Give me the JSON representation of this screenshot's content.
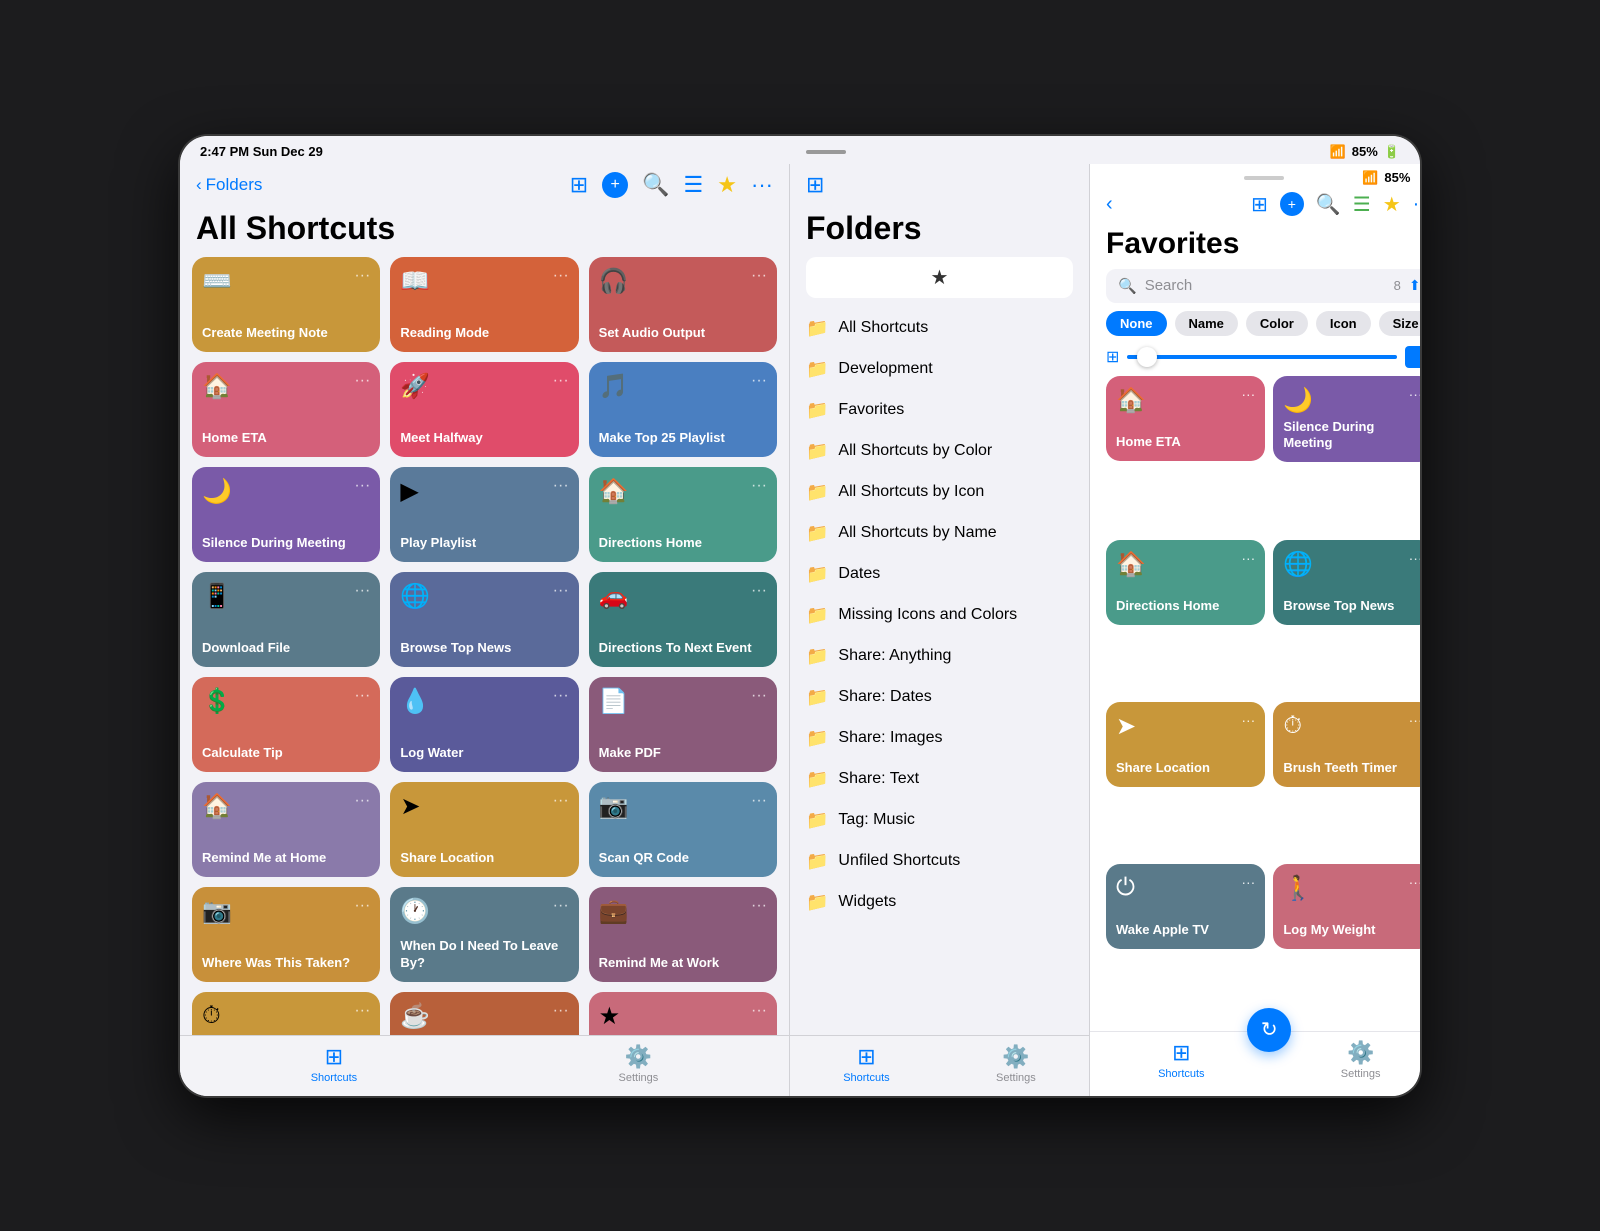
{
  "device": {
    "status_bar": {
      "time": "2:47 PM  Sun Dec 29",
      "wifi": "WiFi",
      "battery": "85%"
    }
  },
  "left_panel": {
    "back_label": "Folders",
    "title": "All Shortcuts",
    "nav_icons": [
      "layers",
      "plus",
      "search",
      "lines",
      "star",
      "dots"
    ],
    "shortcuts": [
      {
        "label": "Create Meeting Note",
        "icon": "⌨️",
        "color": "c-golden"
      },
      {
        "label": "Reading Mode",
        "icon": "📖",
        "color": "c-orange"
      },
      {
        "label": "Set Audio Output",
        "icon": "🎧",
        "color": "c-rose"
      },
      {
        "label": "Home ETA",
        "icon": "🏠",
        "color": "c-pink"
      },
      {
        "label": "Meet Halfway",
        "icon": "🚀",
        "color": "c-rocket"
      },
      {
        "label": "Make Top 25 Playlist",
        "icon": "☰",
        "color": "c-blue"
      },
      {
        "label": "Silence During Meeting",
        "icon": "🌙",
        "color": "c-purple"
      },
      {
        "label": "Play Playlist",
        "icon": "≡",
        "color": "c-gray-blue"
      },
      {
        "label": "Directions Home",
        "icon": "🏠",
        "color": "c-teal"
      },
      {
        "label": "Download File",
        "icon": "📱",
        "color": "c-slate"
      },
      {
        "label": "Browse Top News",
        "icon": "🌐",
        "color": "c-muted-blue"
      },
      {
        "label": "Directions To Next Event",
        "icon": "🚗",
        "color": "c-dark-teal"
      },
      {
        "label": "Calculate Tip",
        "icon": "💲",
        "color": "c-salmon"
      },
      {
        "label": "Log Water",
        "icon": "💧",
        "color": "c-indigo"
      },
      {
        "label": "Make PDF",
        "icon": "📄",
        "color": "c-mauve"
      },
      {
        "label": "Remind Me at Home",
        "icon": "🏠",
        "color": "c-lavender"
      },
      {
        "label": "Share Location",
        "icon": "➤",
        "color": "c-amber"
      },
      {
        "label": "Scan QR Code",
        "icon": "📷",
        "color": "c-steel"
      },
      {
        "label": "Where Was This Taken?",
        "icon": "📷",
        "color": "c-gold"
      },
      {
        "label": "When Do I Need To Leave By?",
        "icon": "🕐",
        "color": "c-slate"
      },
      {
        "label": "Remind Me at Work",
        "icon": "💼",
        "color": "c-mauve"
      },
      {
        "label": "",
        "icon": "⏱",
        "color": "c-amber"
      },
      {
        "label": "",
        "icon": "☕",
        "color": "c-rust"
      },
      {
        "label": "",
        "icon": "★",
        "color": "c-warm-rose"
      }
    ],
    "tab_bar": {
      "shortcuts_label": "Shortcuts",
      "settings_label": "Settings"
    }
  },
  "middle_panel": {
    "title": "Folders",
    "star_label": "★",
    "folders": [
      {
        "label": "All Shortcuts"
      },
      {
        "label": "Development"
      },
      {
        "label": "Favorites"
      },
      {
        "label": "All Shortcuts by Color"
      },
      {
        "label": "All Shortcuts by Icon"
      },
      {
        "label": "All Shortcuts by Name"
      },
      {
        "label": "Dates"
      },
      {
        "label": "Missing Icons and Colors"
      },
      {
        "label": "Share: Anything"
      },
      {
        "label": "Share: Dates"
      },
      {
        "label": "Share: Images"
      },
      {
        "label": "Share: Text"
      },
      {
        "label": "Tag: Music"
      },
      {
        "label": "Unfiled Shortcuts"
      },
      {
        "label": "Widgets"
      }
    ],
    "tab_bar": {
      "shortcuts_label": "Shortcuts",
      "settings_label": "Settings"
    }
  },
  "right_panel": {
    "status_bar": {
      "battery": "85%",
      "wifi": "WiFi"
    },
    "back_label": "‹",
    "title": "Favorites",
    "search_placeholder": "Search",
    "search_count": "8",
    "filter_options": [
      "None",
      "Name",
      "Color",
      "Icon",
      "Size"
    ],
    "active_filter": "None",
    "favorites": [
      {
        "label": "Home ETA",
        "icon": "🏠",
        "color": "c-pink"
      },
      {
        "label": "Silence During Meeting",
        "icon": "🌙",
        "color": "c-purple"
      },
      {
        "label": "Directions Home",
        "icon": "🏠",
        "color": "c-teal"
      },
      {
        "label": "Browse Top News",
        "icon": "🌐",
        "color": "c-dark-teal"
      },
      {
        "label": "Share Location",
        "icon": "➤",
        "color": "c-amber"
      },
      {
        "label": "Brush Teeth Timer",
        "icon": "⏱",
        "color": "c-gold"
      },
      {
        "label": "Wake Apple TV",
        "icon": "⏻",
        "color": "c-slate"
      },
      {
        "label": "Log My Weight",
        "icon": "🚶",
        "color": "c-warm-rose"
      }
    ],
    "tab_bar": {
      "shortcuts_label": "Shortcuts",
      "settings_label": "Settings"
    },
    "refresh_icon": "↻"
  }
}
